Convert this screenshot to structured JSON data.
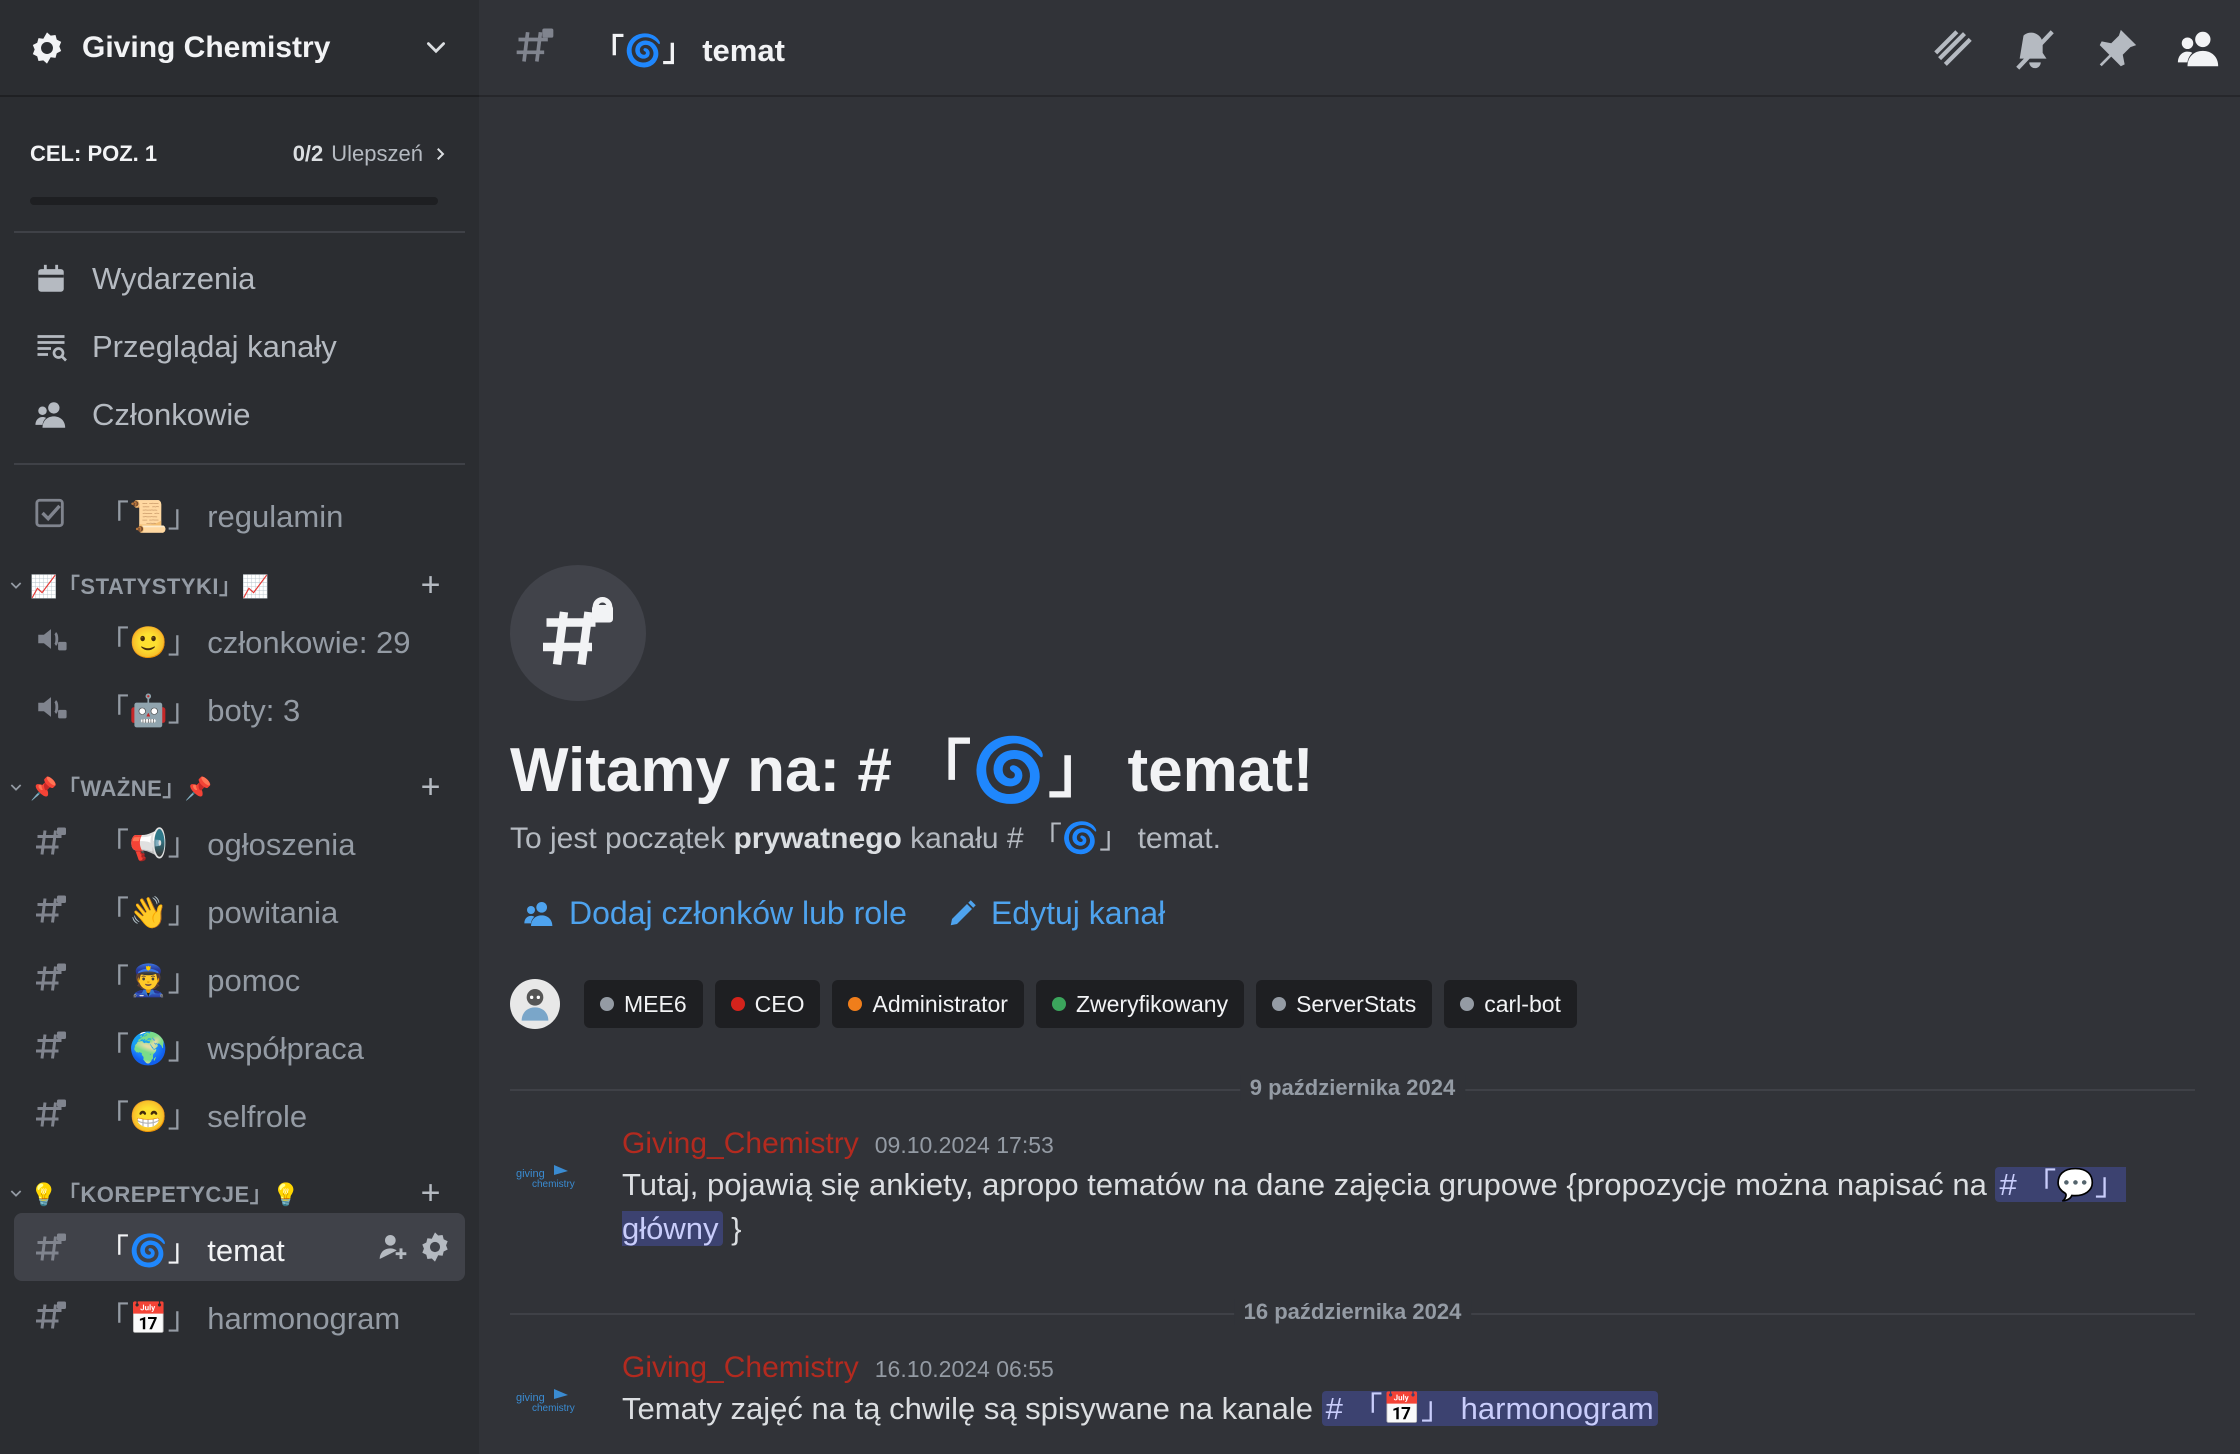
{
  "server": {
    "name": "Giving Chemistry"
  },
  "boost": {
    "goal": "CEL: POZ. 1",
    "count": "0/2",
    "count_label": "Ulepszeń",
    "progress": 0
  },
  "nav": [
    {
      "label": "Wydarzenia",
      "icon": "calendar-icon"
    },
    {
      "label": "Przeglądaj kanały",
      "icon": "browse-channels-icon"
    },
    {
      "label": "Członkowie",
      "icon": "members-icon"
    }
  ],
  "top_channel": {
    "name": "「📜」 regulamin"
  },
  "categories": [
    {
      "name": "📈「STATYSTYKI」📈",
      "channels": [
        "「🙂」 członkowie: 29",
        "「🤖」 boty: 3"
      ]
    },
    {
      "name": "📌「WAŻNE」📌",
      "channels": [
        "「📢」 ogłoszenia",
        "「👋」 powitania",
        "「👮」 pomoc",
        "「🌍」 współpraca",
        "「😁」 selfrole"
      ]
    },
    {
      "name": "💡「KOREPETYCJE」💡",
      "channels": [
        "「🌀」 temat",
        "「📅」 harmonogram"
      ]
    }
  ],
  "header": {
    "channel": "「🌀」 temat"
  },
  "welcome": {
    "title": "Witamy na: # 「🌀」 temat!",
    "sub_prefix": "To jest początek ",
    "sub_bold": "prywatnego",
    "sub_suffix": " kanału # 「🌀」 temat.",
    "add_members": "Dodaj członków lub role",
    "edit_channel": "Edytuj kanał"
  },
  "roles": [
    {
      "name": "MEE6",
      "color": "#949ba4"
    },
    {
      "name": "CEO",
      "color": "#d4231c"
    },
    {
      "name": "Administrator",
      "color": "#f07e1b"
    },
    {
      "name": "Zweryfikowany",
      "color": "#3ba55c"
    },
    {
      "name": "ServerStats",
      "color": "#949ba4"
    },
    {
      "name": "carl-bot",
      "color": "#949ba4"
    }
  ],
  "messages": [
    {
      "date": "9 października 2024",
      "author": "Giving_Chemistry",
      "time": "09.10.2024 17:53",
      "text": "Tutaj, pojawią się ankiety, apropo tematów na dane zajęcia grupowe {propozycje można napisać na ",
      "mention": "# 「💬」 główny",
      "tail": " }"
    },
    {
      "date": "16 października 2024",
      "author": "Giving_Chemistry",
      "time": "16.10.2024 06:55",
      "text": "Tematy zajęć na tą chwilę są spisywane na kanale ",
      "mention": "# 「📅」 harmonogram",
      "tail": ""
    }
  ]
}
